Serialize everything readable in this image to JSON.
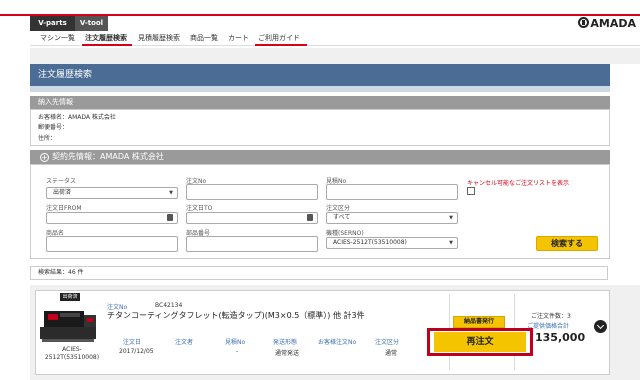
{
  "topbar": {
    "tabs": [
      {
        "label": "V-parts"
      },
      {
        "label": "V-tool"
      }
    ],
    "logo_text": "AMADA"
  },
  "nav": {
    "items": [
      {
        "label": "マシン一覧"
      },
      {
        "label": "注文履歴検索"
      },
      {
        "label": "見積履歴検索"
      },
      {
        "label": "商品一覧"
      },
      {
        "label": "カート"
      },
      {
        "label": "ご利用ガイド"
      }
    ]
  },
  "page": {
    "title": "注文履歴検索"
  },
  "delivery": {
    "heading": "納入先情報",
    "customer": "お客様名：AMADA 株式会社",
    "postal": "郵便番号：",
    "address": "住所："
  },
  "contract": {
    "heading": "契約先情報：AMADA 株式会社",
    "toggle_symbol": "+"
  },
  "search": {
    "status_label": "ステータス",
    "status_value": "出荷済",
    "order_no_label": "注文No",
    "order_no_value": "",
    "quote_no_label": "見積No",
    "quote_no_value": "",
    "date_from_label": "注文日FROM",
    "date_from_value": "",
    "date_to_label": "注文日TO",
    "date_to_value": "",
    "order_type_label": "注文区分",
    "order_type_value": "すべて",
    "product_name_label": "商品名",
    "product_name_value": "",
    "part_no_label": "部品番号",
    "part_no_value": "",
    "model_label": "機種(SERNO)",
    "model_value": "ACIES-2512T(53510008)",
    "cancel_text": "キャンセル可能なご注文リストを表示",
    "search_button": "検索する"
  },
  "results": {
    "count_text": "検索結果：46 件"
  },
  "order": {
    "status": "出荷済",
    "machine_label": "ACIES-2512T(53510008)",
    "order_no_label": "注文No",
    "order_no_value": "BC42134",
    "title": "チタンコーティングタフレット(転造タップ)(M3×0.5（標準）)  他 計3件",
    "date_label": "注文日",
    "date_value": "2017/12/05",
    "orderer_label": "注文者",
    "quote_no_label": "見積No",
    "quote_no_value": "-",
    "ship_label": "発送形態",
    "ship_value": "通常発送",
    "customer_order_label": "お客様注文No",
    "order_type_label": "注文区分",
    "order_type_value": "通常",
    "delivery_button": "納品書発行",
    "reorder_button": "再注文",
    "total_count": "ご注文件数：3",
    "price_label": "ご提供価格合計",
    "price": "135,000"
  },
  "colors": {
    "brand_red": "#d9001b",
    "title_blue": "#4a6c95",
    "button_yellow": "#f5c400"
  }
}
